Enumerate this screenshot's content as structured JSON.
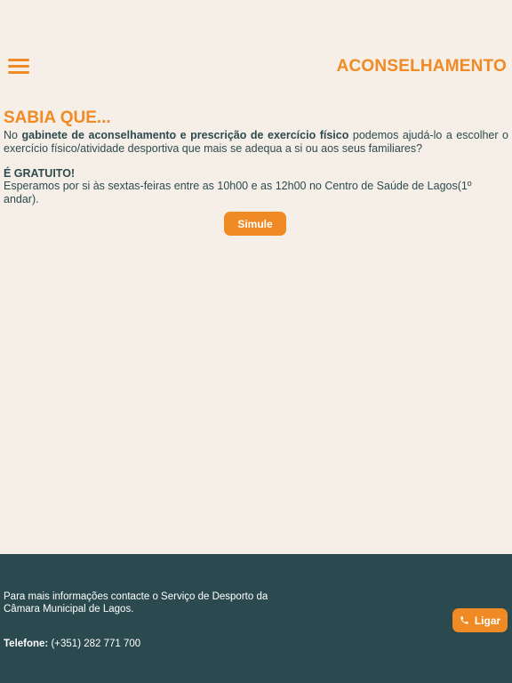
{
  "header": {
    "menu_icon": "hamburger-menu-icon",
    "title": "ACONSELHAMENTO"
  },
  "main": {
    "heading": "SABIA QUE...",
    "intro_prefix": "No ",
    "intro_bold": "gabinete de aconselhamento e prescrição de exercício físico",
    "intro_suffix": " podemos ajudá-lo a escolher o exercício físico/atividade desportiva que mais se adequa a si ou aos seus familiares?",
    "free_title": "É GRATUITO!",
    "free_text": "Esperamos por si às sextas-feiras entre as 10h00 e as 12h00 no Centro de Saúde de Lagos(1º andar).",
    "simulate_button": "Simule"
  },
  "footer": {
    "info": "Para mais informações contacte o Serviço de Desporto da Câmara Municipal de Lagos.",
    "phone_label": "Telefone:",
    "phone_number": " (+351) 282 771 700",
    "call_button": "Ligar",
    "call_icon": "phone-icon"
  },
  "colors": {
    "accent": "#f08a24",
    "background": "#f5efe7",
    "footer_bg": "#2b4a4f",
    "text": "#2d4a50"
  }
}
